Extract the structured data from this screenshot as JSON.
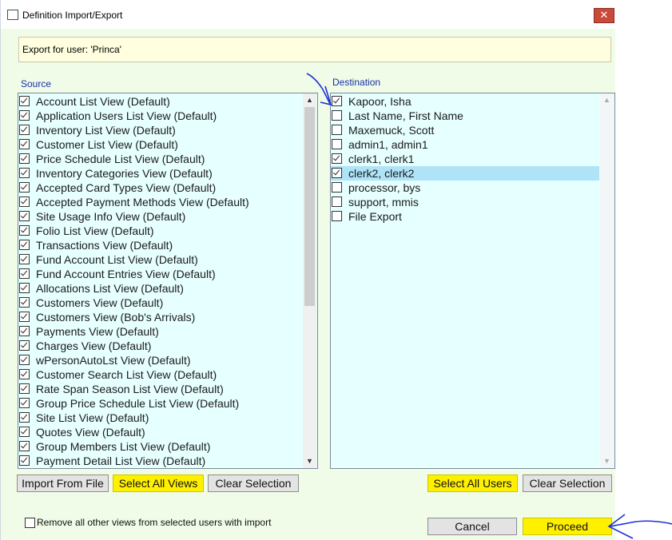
{
  "window": {
    "title": "Definition Import/Export",
    "close_glyph": "✕"
  },
  "export_info": "Export for user: 'Princa'",
  "source": {
    "label": "Source",
    "items": [
      {
        "label": "Account List View (Default)",
        "checked": true
      },
      {
        "label": "Application Users List View (Default)",
        "checked": true
      },
      {
        "label": "Inventory List View (Default)",
        "checked": true
      },
      {
        "label": "Customer List View (Default)",
        "checked": true
      },
      {
        "label": "Price Schedule List View (Default)",
        "checked": true
      },
      {
        "label": "Inventory Categories View (Default)",
        "checked": true
      },
      {
        "label": "Accepted Card Types View (Default)",
        "checked": true
      },
      {
        "label": "Accepted Payment Methods View (Default)",
        "checked": true
      },
      {
        "label": "Site Usage Info View (Default)",
        "checked": true
      },
      {
        "label": "Folio List View (Default)",
        "checked": true
      },
      {
        "label": "Transactions View (Default)",
        "checked": true
      },
      {
        "label": "Fund Account List View (Default)",
        "checked": true
      },
      {
        "label": "Fund Account Entries View (Default)",
        "checked": true
      },
      {
        "label": "Allocations List View (Default)",
        "checked": true
      },
      {
        "label": "Customers View (Default)",
        "checked": true
      },
      {
        "label": "Customers View (Bob's Arrivals)",
        "checked": true
      },
      {
        "label": "Payments View (Default)",
        "checked": true
      },
      {
        "label": "Charges View (Default)",
        "checked": true
      },
      {
        "label": "wPersonAutoLst View (Default)",
        "checked": true
      },
      {
        "label": "Customer Search List View (Default)",
        "checked": true
      },
      {
        "label": "Rate Span Season List View (Default)",
        "checked": true
      },
      {
        "label": "Group Price Schedule List View (Default)",
        "checked": true
      },
      {
        "label": "Site List View (Default)",
        "checked": true
      },
      {
        "label": "Quotes View (Default)",
        "checked": true
      },
      {
        "label": "Group Members List View (Default)",
        "checked": true
      },
      {
        "label": "Payment Detail List View (Default)",
        "checked": true
      }
    ]
  },
  "destination": {
    "label": "Destination",
    "items": [
      {
        "label": "Kapoor, Isha",
        "checked": true
      },
      {
        "label": "Last Name, First Name",
        "checked": false
      },
      {
        "label": "Maxemuck, Scott",
        "checked": false
      },
      {
        "label": "admin1, admin1",
        "checked": false
      },
      {
        "label": "clerk1, clerk1",
        "checked": true
      },
      {
        "label": "clerk2, clerk2",
        "checked": true,
        "selected": true
      },
      {
        "label": "processor, bys",
        "checked": false
      },
      {
        "label": "support, mmis",
        "checked": false
      },
      {
        "label": "File Export",
        "checked": false
      }
    ]
  },
  "buttons": {
    "import_from_file": "Import From File",
    "select_all_views": "Select All Views",
    "clear_selection_left": "Clear Selection",
    "select_all_users": "Select All Users",
    "clear_selection_right": "Clear Selection",
    "cancel": "Cancel",
    "proceed": "Proceed"
  },
  "remove_option": {
    "label": "Remove all other views from selected users with import",
    "checked": false
  },
  "colors": {
    "highlight": "#fff000",
    "annotation": "#1f2fd6",
    "list_bg": "#e6ffff",
    "window_bg": "#f0fbe8"
  }
}
